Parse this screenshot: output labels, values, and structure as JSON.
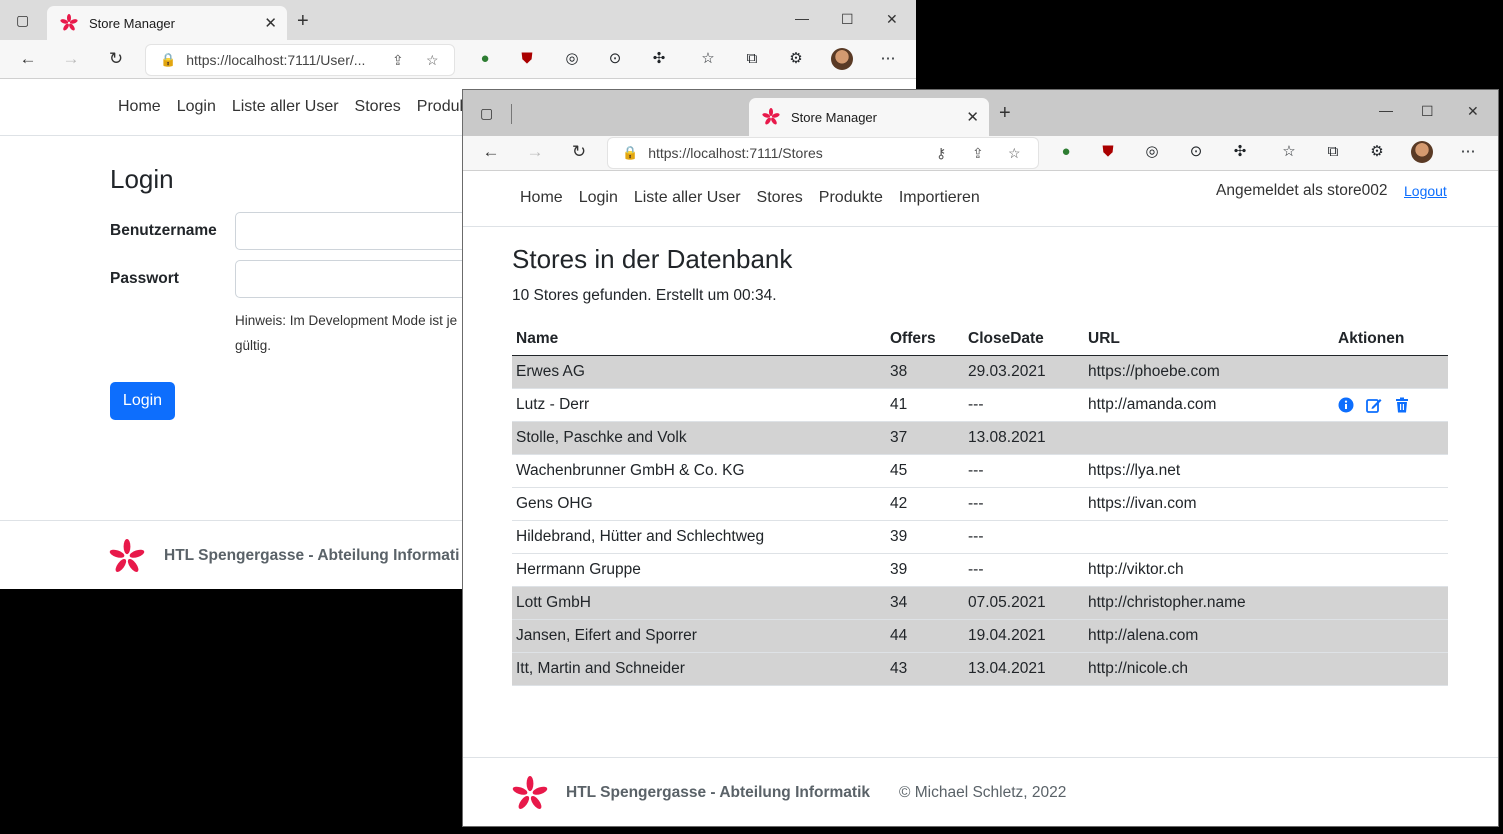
{
  "back_window": {
    "tab_title": "Store Manager",
    "url": "https://localhost:7111/User/...",
    "nav": [
      "Home",
      "Login",
      "Liste aller User",
      "Stores",
      "Produkt"
    ],
    "login": {
      "heading": "Login",
      "username_label": "Benutzername",
      "password_label": "Passwort",
      "hint_line1": "Hinweis: Im Development Mode ist je",
      "hint_line2": "gültig.",
      "button": "Login"
    },
    "footer": "HTL Spengergasse - Abteilung Informati"
  },
  "front_window": {
    "tab_title": "Store Manager",
    "url": "https://localhost:7111/Stores",
    "nav": [
      "Home",
      "Login",
      "Liste aller User",
      "Stores",
      "Produkte",
      "Importieren"
    ],
    "user_status": "Angemeldet als store002",
    "logout": "Logout",
    "heading": "Stores in der Datenbank",
    "subtitle": "10 Stores gefunden. Erstellt um 00:34.",
    "table": {
      "columns": [
        "Name",
        "Offers",
        "CloseDate",
        "URL",
        "Aktionen"
      ],
      "rows": [
        {
          "name": "Erwes AG",
          "offers": "38",
          "close": "29.03.2021",
          "url": "https://phoebe.com",
          "grey": true,
          "actions": false
        },
        {
          "name": "Lutz - Derr",
          "offers": "41",
          "close": "---",
          "url": "http://amanda.com",
          "grey": false,
          "actions": true
        },
        {
          "name": "Stolle, Paschke and Volk",
          "offers": "37",
          "close": "13.08.2021",
          "url": "",
          "grey": true,
          "actions": false
        },
        {
          "name": "Wachenbrunner GmbH & Co. KG",
          "offers": "45",
          "close": "---",
          "url": "https://lya.net",
          "grey": false,
          "actions": false
        },
        {
          "name": "Gens OHG",
          "offers": "42",
          "close": "---",
          "url": "https://ivan.com",
          "grey": false,
          "actions": false
        },
        {
          "name": "Hildebrand, Hütter and Schlechtweg",
          "offers": "39",
          "close": "---",
          "url": "",
          "grey": false,
          "actions": false
        },
        {
          "name": "Herrmann Gruppe",
          "offers": "39",
          "close": "---",
          "url": "http://viktor.ch",
          "grey": false,
          "actions": false
        },
        {
          "name": "Lott GmbH",
          "offers": "34",
          "close": "07.05.2021",
          "url": "http://christopher.name",
          "grey": true,
          "actions": false
        },
        {
          "name": "Jansen, Eifert and Sporrer",
          "offers": "44",
          "close": "19.04.2021",
          "url": "http://alena.com",
          "grey": true,
          "actions": false
        },
        {
          "name": "Itt, Martin and Schneider",
          "offers": "43",
          "close": "13.04.2021",
          "url": "http://nicole.ch",
          "grey": true,
          "actions": false
        }
      ]
    },
    "footer_org": "HTL Spengergasse - Abteilung Informatik",
    "footer_copy": "© Michael Schletz, 2022"
  },
  "colors": {
    "primary": "#0d6efd",
    "row_grey": "#d3d3d3",
    "logo": "#e8194a"
  }
}
